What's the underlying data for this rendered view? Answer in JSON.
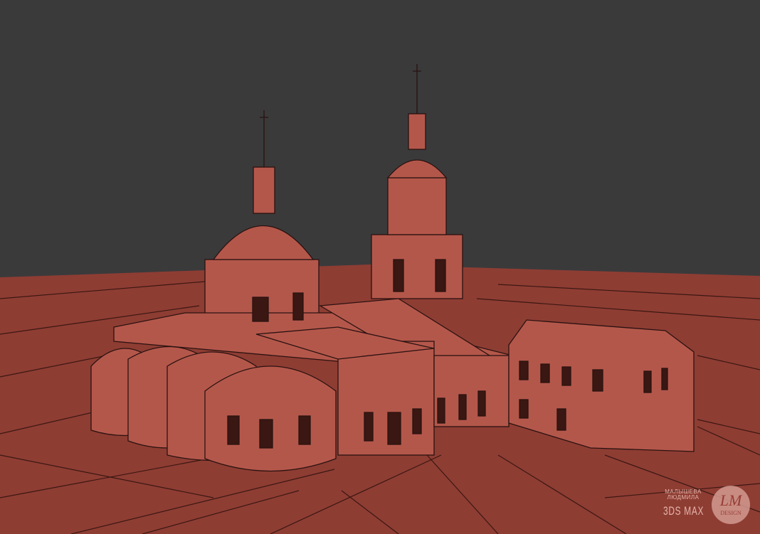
{
  "scene": {
    "software": "3DS MAX",
    "colors": {
      "sky": "#3a3a3b",
      "ground": "#8e3d33",
      "model": "#b4574b",
      "wire": "#2a1210"
    }
  },
  "watermark": {
    "author": "МАЛЫШЕВА ЛЮДМИЛА",
    "software": "3DS MAX",
    "logo_monogram": "LM",
    "logo_text": "DESIGN"
  }
}
